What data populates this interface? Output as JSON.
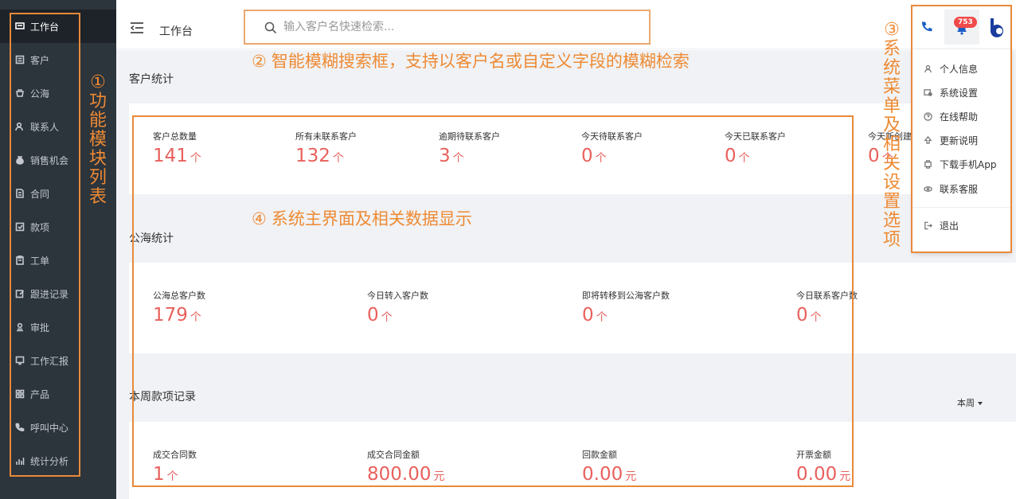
{
  "sidebar": {
    "items": [
      {
        "label": "工作台",
        "icon": "dashboard-icon",
        "active": true
      },
      {
        "label": "客户",
        "icon": "customer-icon"
      },
      {
        "label": "公海",
        "icon": "public-pool-icon"
      },
      {
        "label": "联系人",
        "icon": "contact-icon"
      },
      {
        "label": "销售机会",
        "icon": "money-bag-icon"
      },
      {
        "label": "合同",
        "icon": "contract-icon"
      },
      {
        "label": "款项",
        "icon": "payment-icon"
      },
      {
        "label": "工单",
        "icon": "ticket-icon"
      },
      {
        "label": "跟进记录",
        "icon": "edit-icon"
      },
      {
        "label": "审批",
        "icon": "approval-icon"
      },
      {
        "label": "工作汇报",
        "icon": "report-icon"
      },
      {
        "label": "产品",
        "icon": "grid-icon"
      },
      {
        "label": "呼叫中心",
        "icon": "phone-icon"
      },
      {
        "label": "统计分析",
        "icon": "bar-chart-icon"
      }
    ]
  },
  "header": {
    "title": "工作台",
    "search_placeholder": "输入客户名快速检索...",
    "notification_count": "753"
  },
  "user_menu": {
    "items": [
      {
        "label": "个人信息",
        "icon": "user-icon"
      },
      {
        "label": "系统设置",
        "icon": "settings-icon"
      },
      {
        "label": "在线帮助",
        "icon": "help-icon"
      },
      {
        "label": "更新说明",
        "icon": "update-icon"
      },
      {
        "label": "下载手机App",
        "icon": "app-icon"
      },
      {
        "label": "联系客服",
        "icon": "service-icon"
      }
    ],
    "logout": {
      "label": "退出",
      "icon": "logout-icon"
    }
  },
  "customer_stats": {
    "title": "客户统计",
    "items": [
      {
        "label": "客户总数量",
        "value": "141",
        "unit": "个"
      },
      {
        "label": "所有未联系客户",
        "value": "132",
        "unit": "个"
      },
      {
        "label": "逾期待联系客户",
        "value": "3",
        "unit": "个"
      },
      {
        "label": "今天待联系客户",
        "value": "0",
        "unit": "个"
      },
      {
        "label": "今天已联系客户",
        "value": "0",
        "unit": "个"
      },
      {
        "label": "今天新创建",
        "value": "0",
        "unit": "个"
      }
    ]
  },
  "pool_stats": {
    "title": "公海统计",
    "items": [
      {
        "label": "公海总客户数",
        "value": "179",
        "unit": "个"
      },
      {
        "label": "今日转入客户数",
        "value": "0",
        "unit": "个"
      },
      {
        "label": "即将转移到公海客户数",
        "value": "0",
        "unit": "个"
      },
      {
        "label": "今日联系客户数",
        "value": "0",
        "unit": "个"
      }
    ]
  },
  "payment_stats": {
    "title": "本周款项记录",
    "period": "本周",
    "items": [
      {
        "label": "成交合同数",
        "value": "1",
        "unit": "个"
      },
      {
        "label": "成交合同金额",
        "value": "800.00",
        "unit": "元"
      },
      {
        "label": "回款金额",
        "value": "0.00",
        "unit": "元"
      },
      {
        "label": "开票金额",
        "value": "0.00",
        "unit": "元"
      }
    ]
  },
  "annotations": {
    "one": {
      "num": "①",
      "text": "功能模块列表"
    },
    "two": {
      "num": "②",
      "text": "智能模糊搜索框，支持以客户名或自定义字段的模糊检索"
    },
    "three": {
      "num": "③",
      "text": "系统菜单及相关设置选项"
    },
    "four": {
      "num": "④",
      "text": "系统主界面及相关数据显示"
    }
  },
  "colors": {
    "sidebar_bg": "#2c343c",
    "value_red": "#e8615d",
    "annotation_orange": "#ee8a33",
    "badge_red": "#f04a4a",
    "brand_blue": "#1a3d9e"
  }
}
